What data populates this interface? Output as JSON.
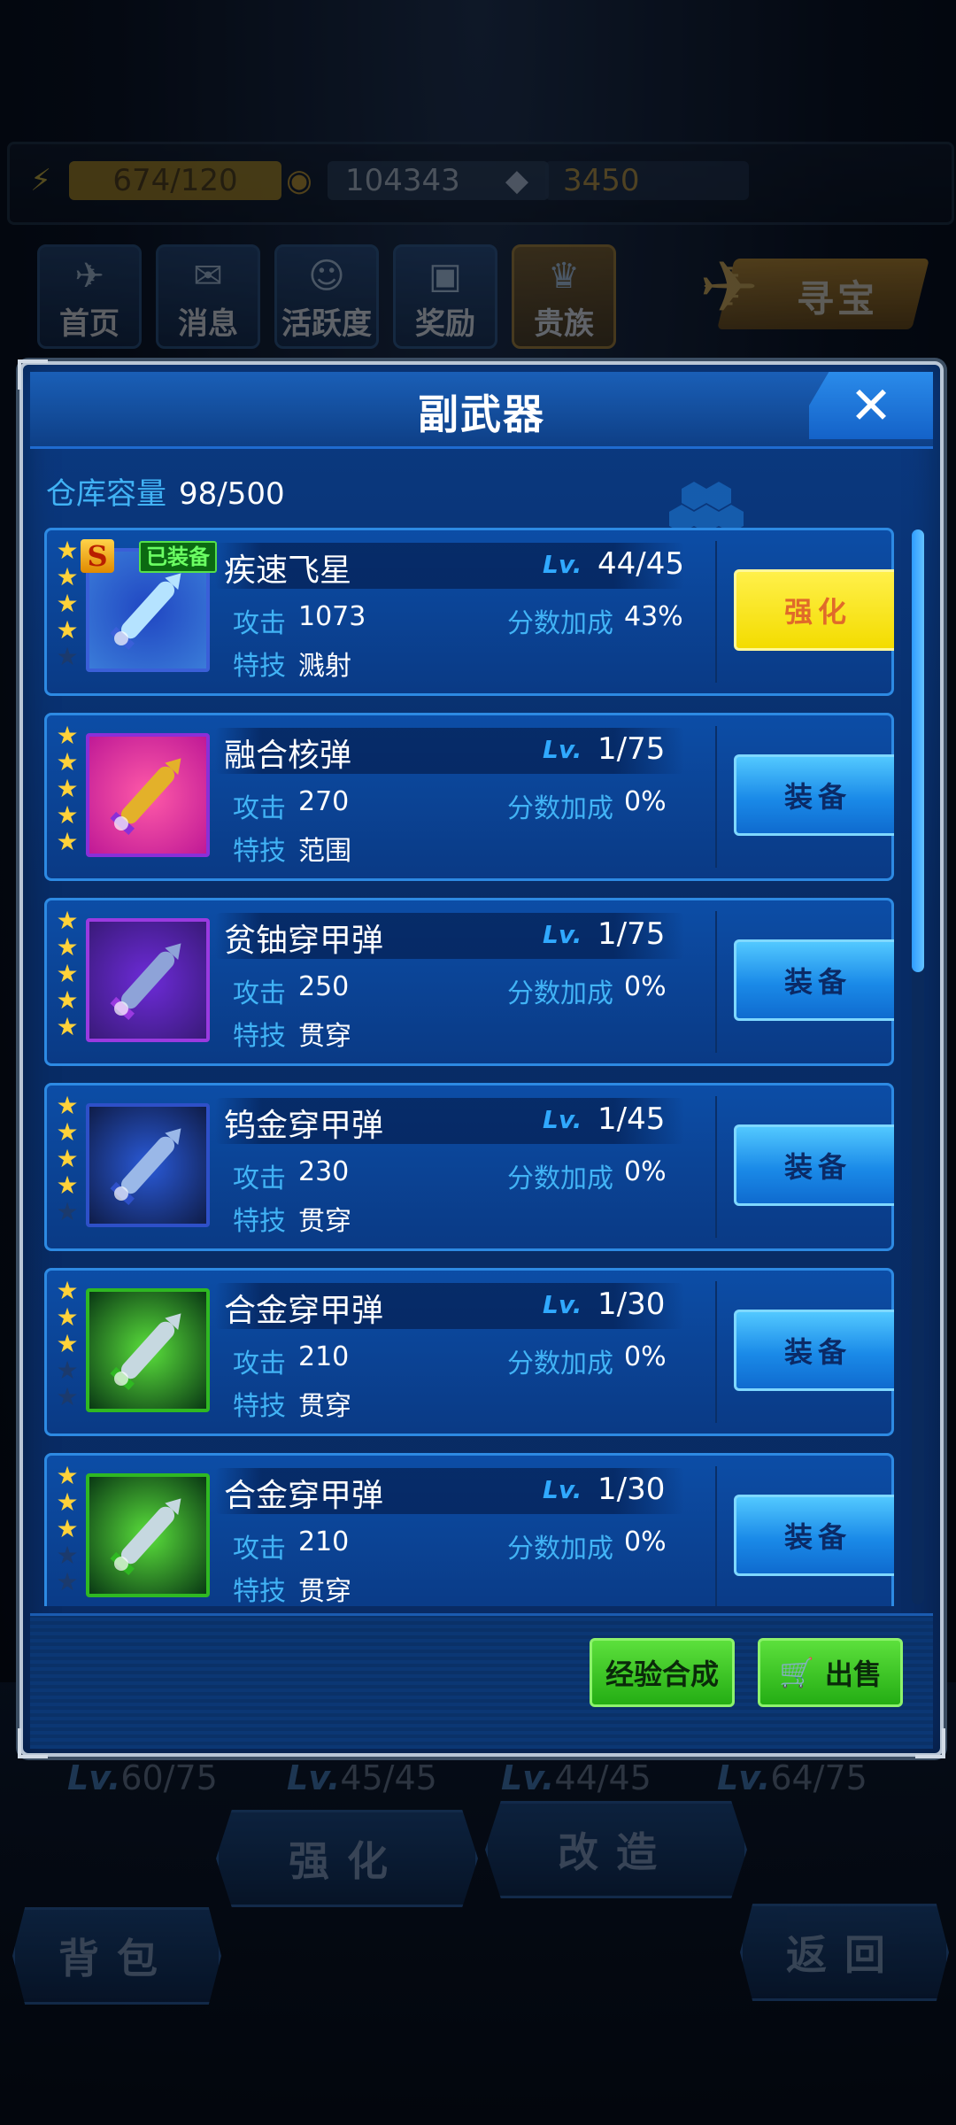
{
  "resources": {
    "energy": "674/120",
    "gold": "104343",
    "gems": "3450"
  },
  "top_nav": [
    {
      "label": "首页",
      "icon": "jet-icon"
    },
    {
      "label": "消息",
      "icon": "mail-icon"
    },
    {
      "label": "活跃度",
      "icon": "smile-badge-icon"
    },
    {
      "label": "奖励",
      "icon": "gift-icon"
    },
    {
      "label": "贵族",
      "icon": "noble-crest-icon"
    }
  ],
  "treasure_label": "寻宝",
  "dialog": {
    "title": "副武器",
    "close_symbol": "✕",
    "capacity_label": "仓库容量",
    "capacity_value": "98/500",
    "lv_prefix": "Lv.",
    "stat_labels": {
      "attack": "攻击",
      "score": "分数加成",
      "skill": "特技"
    },
    "equipped_badge": "已装备",
    "rank_badge": "S",
    "weapons": [
      {
        "name": "疾速飞星",
        "level": "44/45",
        "attack": "1073",
        "score_bonus": "43%",
        "skill": "溅射",
        "stars": 5,
        "stars_filled": 4,
        "button": "强化",
        "button_style": "yellow",
        "equipped": true,
        "thumb_palette": "blue-burst"
      },
      {
        "name": "融合核弹",
        "level": "1/75",
        "attack": "270",
        "score_bonus": "0%",
        "skill": "范围",
        "stars": 5,
        "stars_filled": 5,
        "button": "装备",
        "button_style": "blue",
        "equipped": false,
        "thumb_palette": "gold-missile"
      },
      {
        "name": "贫铀穿甲弹",
        "level": "1/75",
        "attack": "250",
        "score_bonus": "0%",
        "skill": "贯穿",
        "stars": 5,
        "stars_filled": 5,
        "button": "装备",
        "button_style": "blue",
        "equipped": false,
        "thumb_palette": "purple-missile"
      },
      {
        "name": "钨金穿甲弹",
        "level": "1/45",
        "attack": "230",
        "score_bonus": "0%",
        "skill": "贯穿",
        "stars": 5,
        "stars_filled": 4,
        "button": "装备",
        "button_style": "blue",
        "equipped": false,
        "thumb_palette": "blue-missile"
      },
      {
        "name": "合金穿甲弹",
        "level": "1/30",
        "attack": "210",
        "score_bonus": "0%",
        "skill": "贯穿",
        "stars": 5,
        "stars_filled": 3,
        "button": "装备",
        "button_style": "blue",
        "equipped": false,
        "thumb_palette": "green-missile"
      },
      {
        "name": "合金穿甲弹",
        "level": "1/30",
        "attack": "210",
        "score_bonus": "0%",
        "skill": "贯穿",
        "stars": 5,
        "stars_filled": 3,
        "button": "装备",
        "button_style": "blue",
        "equipped": false,
        "thumb_palette": "green-missile"
      }
    ],
    "footer": {
      "exp_merge": "经验合成",
      "sell": "出售",
      "sell_icon": "cart-icon"
    }
  },
  "background": {
    "levels": [
      "60/75",
      "45/45",
      "44/45",
      "64/75"
    ],
    "upgrade_label": "强化",
    "modify_label": "改造",
    "bag_label": "背包",
    "back_label": "返回"
  },
  "colors": {
    "accent_blue": "#2d8ae3",
    "label_blue": "#41b3f5",
    "button_yellow": "#f3dc00",
    "button_green": "#24ad14",
    "star": "#ffd23a"
  }
}
